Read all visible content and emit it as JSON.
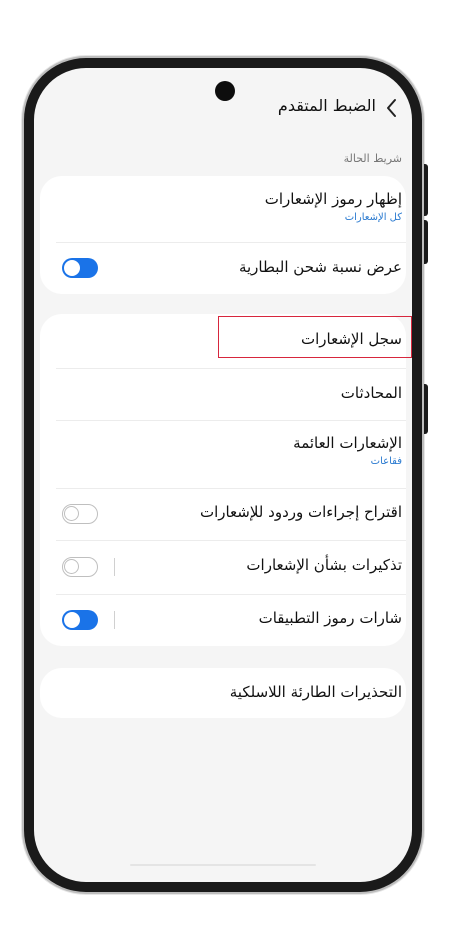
{
  "header": {
    "title": "الضبط المتقدم",
    "back_icon": "chevron-left-icon"
  },
  "status_bar_section": {
    "label": "شريط الحالة"
  },
  "card1": {
    "show_notification_icons": {
      "label": "إظهار رموز الإشعارات",
      "value": "كل الإشعارات"
    },
    "battery_percentage": {
      "label": "عرض نسبة شحن البطارية",
      "toggle": "on"
    }
  },
  "card2": {
    "notification_history": {
      "label": "سجل الإشعارات"
    },
    "conversations": {
      "label": "المحادثات"
    },
    "floating_notifications": {
      "label": "الإشعارات العائمة",
      "value": "فقاعات"
    },
    "suggest_actions_replies": {
      "label": "اقتراح إجراءات وردود للإشعارات",
      "toggle": "off"
    },
    "notification_reminders": {
      "label": "تذكيرات بشأن الإشعارات",
      "toggle": "off"
    },
    "app_icon_badges": {
      "label": "شارات رموز التطبيقات",
      "toggle": "on"
    }
  },
  "card3": {
    "wireless_emergency_alerts": {
      "label": "التحذيرات الطارئة اللاسلكية"
    }
  },
  "colors": {
    "accent": "#1a73e8",
    "highlight": "#d7263d",
    "link": "#2a7ad0"
  }
}
